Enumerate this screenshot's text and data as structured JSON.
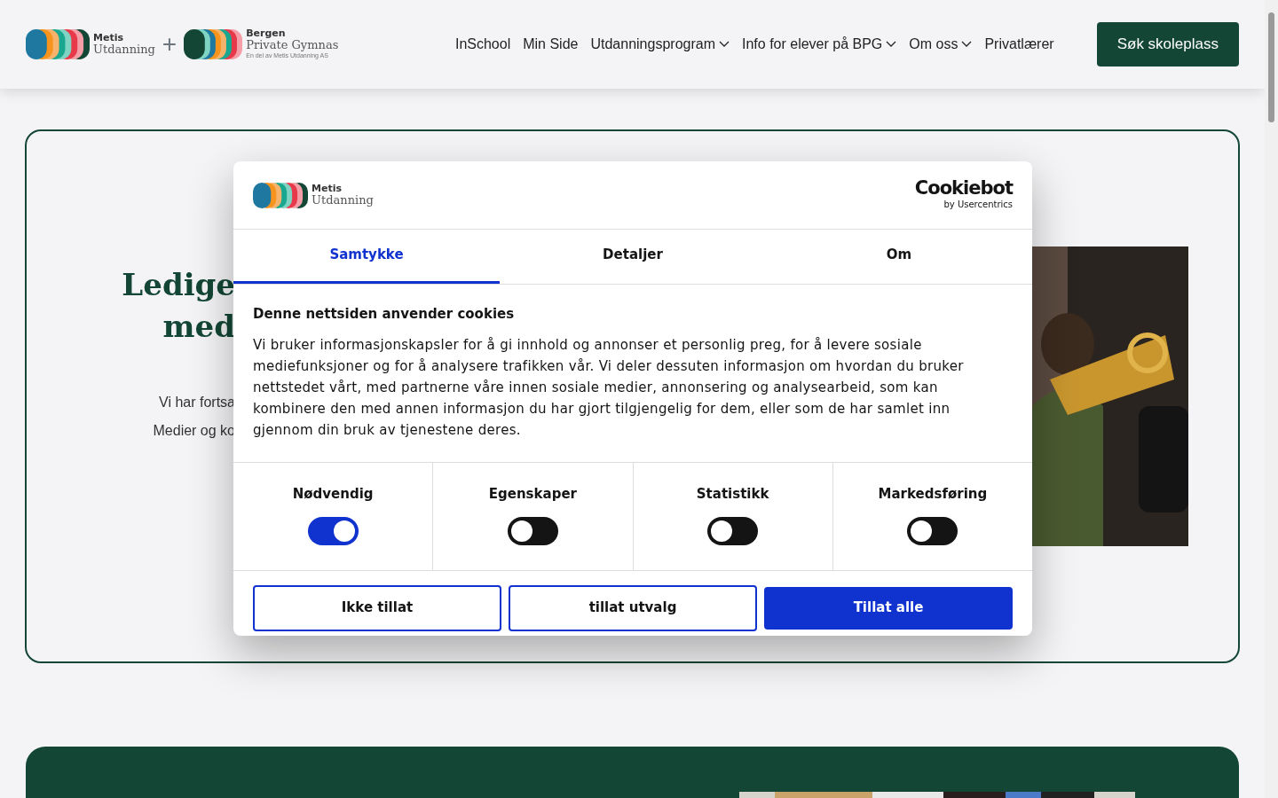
{
  "header": {
    "logos": [
      {
        "title": "Metis",
        "subtitle": "Utdanning"
      },
      {
        "title": "Bergen",
        "subtitle": "Private Gymnas",
        "tagline": "En del av Metis Utdanning AS"
      }
    ],
    "plus": "+",
    "nav": [
      {
        "label": "InSchool",
        "dropdown": false
      },
      {
        "label": "Min Side",
        "dropdown": false
      },
      {
        "label": "Utdanningsprogram",
        "dropdown": true
      },
      {
        "label": "Info for elever på BPG",
        "dropdown": true
      },
      {
        "label": "Om oss",
        "dropdown": true
      },
      {
        "label": "Privatlærer",
        "dropdown": false
      }
    ],
    "cta": "Søk skoleplass"
  },
  "hero": {
    "heading_lines": [
      "Ledige",
      "med"
    ],
    "text_lines": [
      "Vi har fortsa",
      "Medier og ko"
    ]
  },
  "cookie_dialog": {
    "logo": {
      "title": "Metis",
      "subtitle": "Utdanning"
    },
    "brand": {
      "name": "Cookiebot",
      "by": "by Usercentrics"
    },
    "tabs": [
      {
        "label": "Samtykke",
        "selected": true
      },
      {
        "label": "Detaljer",
        "selected": false
      },
      {
        "label": "Om",
        "selected": false
      }
    ],
    "title": "Denne nettsiden anvender cookies",
    "body": "Vi bruker informasjonskapsler for å gi innhold og annonser et personlig preg, for å levere sosiale mediefunksjoner og for å analysere trafikken vår. Vi deler dessuten informasjon om hvordan du bruker nettstedet vårt, med partnerne våre innen sosiale medier, annonsering og analysearbeid, som kan kombinere den med annen informasjon du har gjort tilgjengelig for dem, eller som de har samlet inn gjennom din bruk av tjenestene deres.",
    "categories": [
      {
        "label": "Nødvendig",
        "on": true
      },
      {
        "label": "Egenskaper",
        "on": false
      },
      {
        "label": "Statistikk",
        "on": false
      },
      {
        "label": "Markedsføring",
        "on": false
      }
    ],
    "buttons": [
      {
        "label": "Ikke tillat",
        "kind": "outline"
      },
      {
        "label": "tillat utvalg",
        "kind": "outline"
      },
      {
        "label": "Tillat alle",
        "kind": "filled"
      }
    ]
  }
}
